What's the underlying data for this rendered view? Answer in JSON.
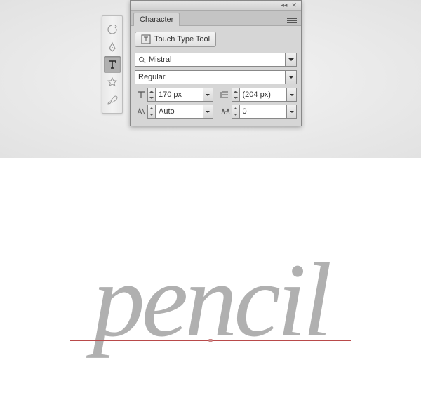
{
  "panel": {
    "collapse_glyph": "◂◂",
    "close_glyph": "✕",
    "tab_label": "Character",
    "touch_type_label": "Touch Type Tool",
    "font_family": "Mistral",
    "font_style": "Regular",
    "font_size": "170 px",
    "leading": "(204 px)",
    "kerning": "Auto",
    "tracking": "0"
  },
  "toolbox": {
    "items": [
      {
        "name": "rotate-tool-icon"
      },
      {
        "name": "pen-tool-icon"
      },
      {
        "name": "type-tool-icon"
      },
      {
        "name": "star-tool-icon"
      },
      {
        "name": "brush-tool-icon"
      }
    ],
    "active_index": 2
  },
  "canvas": {
    "text": "pencil"
  }
}
